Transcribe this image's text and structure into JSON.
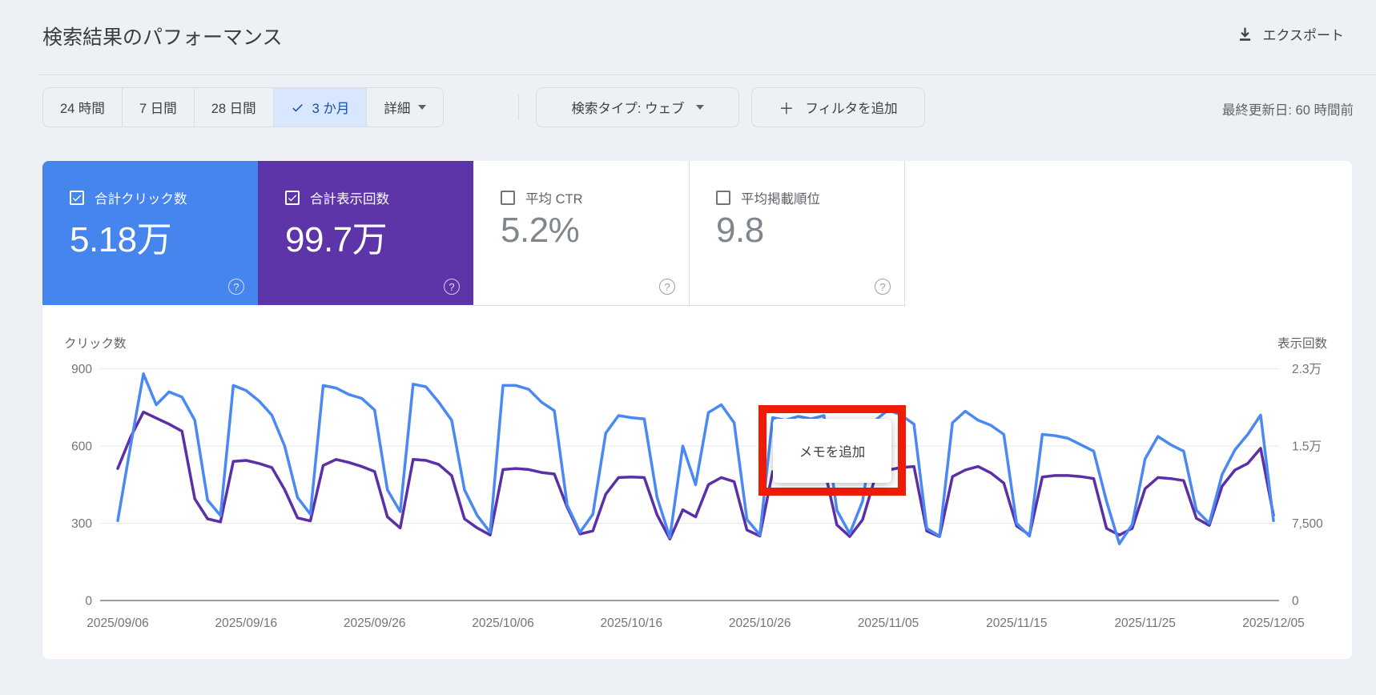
{
  "header": {
    "title": "検索結果のパフォーマンス",
    "export_label": "エクスポート"
  },
  "toolbar": {
    "range_buttons": [
      {
        "label": "24 時間",
        "selected": false
      },
      {
        "label": "7 日間",
        "selected": false
      },
      {
        "label": "28 日間",
        "selected": false
      },
      {
        "label": "3 か月",
        "selected": true
      },
      {
        "label": "詳細",
        "selected": false
      }
    ],
    "search_type_label": "検索タイプ: ウェブ",
    "add_filter_label": "フィルタを追加",
    "last_updated": "最終更新日: 60 時間前"
  },
  "metrics": {
    "cards": [
      {
        "label": "合計クリック数",
        "value": "5.18万",
        "checked": true,
        "color": "#4684ee"
      },
      {
        "label": "合計表示回数",
        "value": "99.7万",
        "checked": true,
        "color": "#5e35a8"
      },
      {
        "label": "平均 CTR",
        "value": "5.2%",
        "checked": false,
        "color": "#ffffff"
      },
      {
        "label": "平均掲載順位",
        "value": "9.8",
        "checked": false,
        "color": "#ffffff"
      }
    ]
  },
  "annotation": {
    "tooltip_label": "メモを追加",
    "highlight_color": "#ee1c04"
  },
  "icons": {
    "plus": "＋",
    "question": "?",
    "download": "download-icon",
    "check": "check-icon",
    "caret": "chevron-down"
  },
  "chart_data": {
    "type": "line",
    "title": "",
    "ylabel_left": "クリック数",
    "ylabel_right": "表示回数",
    "grid": true,
    "legend": "none",
    "date_range": {
      "start": "2025/09/06",
      "end": "2025/12/05"
    },
    "y_left": {
      "max": 900,
      "ticks": [
        900,
        600,
        300,
        0
      ],
      "labels": [
        "900",
        "600",
        "300",
        "0"
      ]
    },
    "y_right": {
      "max": 23000,
      "ticks": [
        23000,
        15000,
        7500,
        0
      ],
      "labels": [
        "2.3万",
        "1.5万",
        "7,500",
        "0"
      ]
    },
    "x_tick_labels": [
      "2025/09/06",
      "2025/09/16",
      "2025/09/26",
      "2025/10/06",
      "2025/10/16",
      "2025/10/26",
      "2025/11/05",
      "2025/11/15",
      "2025/11/25",
      "2025/12/05"
    ],
    "series": [
      {
        "name": "クリック数",
        "axis": "left",
        "color": "#4a89f4",
        "values": [
          310,
          600,
          880,
          760,
          810,
          790,
          700,
          390,
          330,
          835,
          815,
          775,
          720,
          600,
          400,
          335,
          835,
          825,
          800,
          785,
          740,
          430,
          345,
          840,
          830,
          770,
          700,
          430,
          330,
          265,
          835,
          835,
          820,
          770,
          737,
          370,
          265,
          335,
          650,
          718,
          710,
          705,
          400,
          245,
          600,
          450,
          730,
          760,
          690,
          315,
          255,
          710,
          700,
          715,
          705,
          718,
          350,
          260,
          385,
          700,
          740,
          720,
          685,
          280,
          250,
          690,
          735,
          700,
          680,
          645,
          300,
          250,
          645,
          640,
          630,
          605,
          580,
          385,
          220,
          295,
          550,
          637,
          605,
          580,
          350,
          300,
          490,
          585,
          645,
          720,
          310
        ]
      },
      {
        "name": "表示回数",
        "axis": "right",
        "color": "#5b2fa8",
        "values": [
          13100,
          16200,
          18700,
          18100,
          17500,
          16800,
          10100,
          8100,
          7800,
          13800,
          13900,
          13600,
          13200,
          11000,
          8200,
          7900,
          13400,
          14000,
          13700,
          13300,
          12800,
          8300,
          7200,
          14000,
          13900,
          13500,
          12400,
          8100,
          7200,
          6500,
          13000,
          13100,
          13000,
          12700,
          12550,
          9250,
          6600,
          6900,
          10550,
          12200,
          12250,
          12200,
          8500,
          6100,
          9000,
          8300,
          11500,
          12200,
          11800,
          7000,
          6400,
          12800,
          12600,
          12900,
          12800,
          13200,
          7500,
          6350,
          8000,
          12300,
          12950,
          13200,
          13300,
          6900,
          6350,
          12300,
          12950,
          13300,
          12650,
          11650,
          7400,
          6500,
          12250,
          12400,
          12400,
          12300,
          12100,
          7150,
          6500,
          7150,
          11100,
          12200,
          12100,
          11900,
          8150,
          7450,
          11350,
          12950,
          13600,
          15100,
          8450
        ]
      }
    ]
  }
}
